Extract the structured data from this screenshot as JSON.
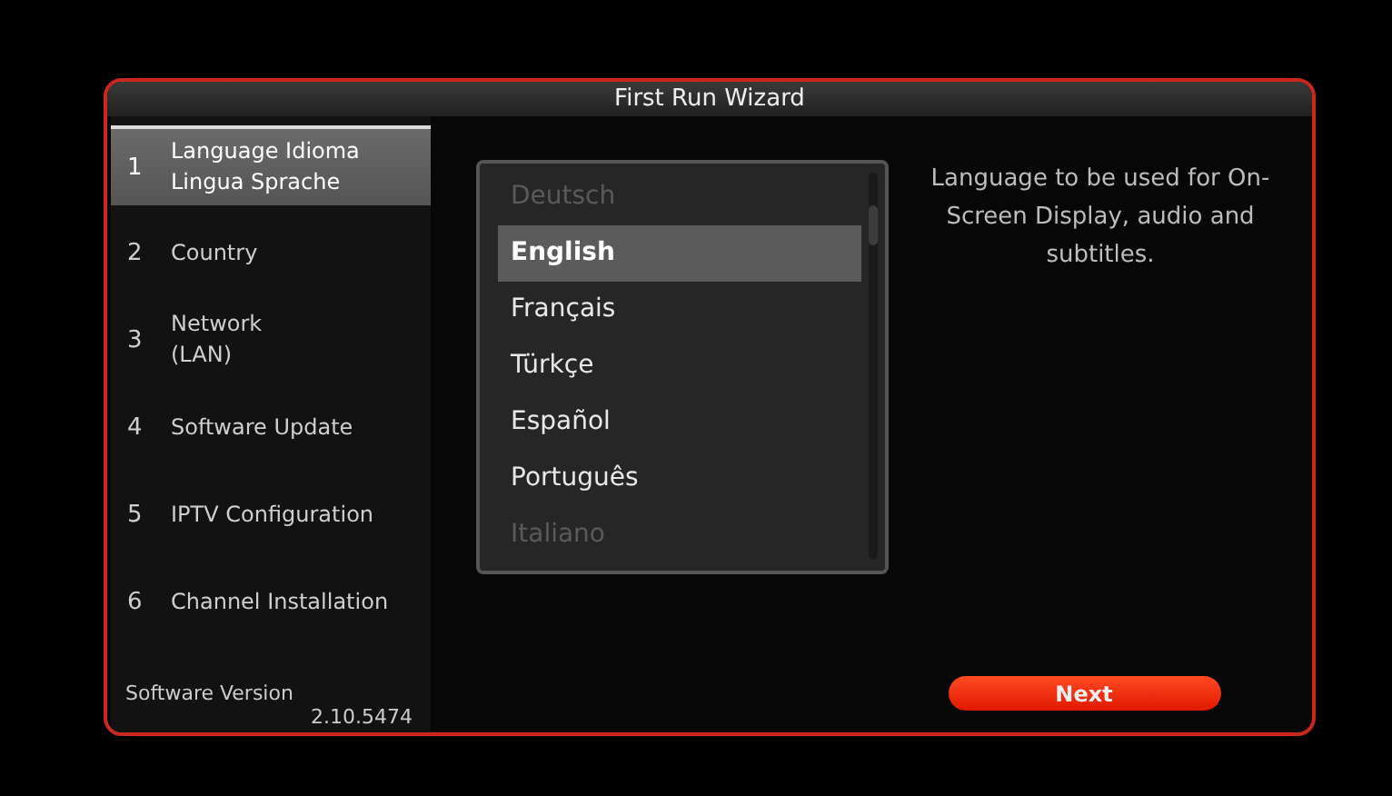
{
  "window": {
    "title": "First Run Wizard"
  },
  "steps": [
    {
      "number": "1",
      "lines": [
        "Language  Idioma",
        "Lingua  Sprache"
      ],
      "selected": true
    },
    {
      "number": "2",
      "lines": [
        "Country"
      ],
      "selected": false
    },
    {
      "number": "3",
      "lines": [
        "Network",
        "(LAN)"
      ],
      "selected": false
    },
    {
      "number": "4",
      "lines": [
        "Software Update"
      ],
      "selected": false
    },
    {
      "number": "5",
      "lines": [
        "IPTV Configuration"
      ],
      "selected": false
    },
    {
      "number": "6",
      "lines": [
        "Channel Installation"
      ],
      "selected": false
    }
  ],
  "software_version": {
    "label": "Software Version",
    "value": "2.10.5474"
  },
  "languages": [
    {
      "label": "Deutsch",
      "selected": false
    },
    {
      "label": "English",
      "selected": true
    },
    {
      "label": "Français",
      "selected": false
    },
    {
      "label": "Türkçe",
      "selected": false
    },
    {
      "label": "Español",
      "selected": false
    },
    {
      "label": "Português",
      "selected": false
    },
    {
      "label": "Italiano",
      "selected": false
    }
  ],
  "description": "Language to be used for On-Screen Display, audio and subtitles.",
  "buttons": {
    "next": "Next"
  }
}
